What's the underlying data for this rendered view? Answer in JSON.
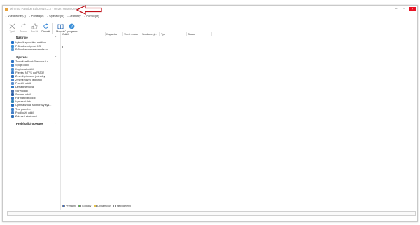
{
  "window": {
    "title": "MiniTool Partition Editor v10.2.3 - Verze: Neomezená"
  },
  "menubar": {
    "items": [
      "Všeobecné(G)",
      "Pohled(V)",
      "Operace(O)",
      "Jednotky",
      "Pomoc(H)"
    ]
  },
  "toolbar": {
    "items": [
      {
        "label": "Zpět",
        "icon": "x-icon"
      },
      {
        "label": "Znovu",
        "icon": "undo-icon"
      },
      {
        "label": "Použít",
        "icon": "thumbs-up-icon"
      },
      {
        "label": "Obnovit",
        "icon": "refresh-icon"
      },
      {
        "label": "Manuál",
        "icon": "book-icon"
      },
      {
        "label": "O programu",
        "icon": "question-icon"
      }
    ]
  },
  "sidebar": {
    "nastroje_title": "Nástroje",
    "nastroje": [
      {
        "label": "Vytvořit spouštěcí médium",
        "color": "#1e6fc9"
      },
      {
        "label": "Průvodce migrací OS",
        "color": "#3a8fd8"
      },
      {
        "label": "Průvodce obnovením disku",
        "color": "#5a9bd5"
      }
    ],
    "operace_title": "Operace",
    "operace": [
      {
        "label": "Změnit velikost/Přesunout o...",
        "color": "#2a72c4"
      },
      {
        "label": "Spojit oddíl",
        "color": "#3f85d1"
      },
      {
        "label": "Kopírovat oddíl",
        "color": "#4a8fd4"
      },
      {
        "label": "Převést NTFS do FAT32",
        "color": "#3a7fcf"
      },
      {
        "label": "Změnit písmeno jednotky",
        "color": "#2c6fbf"
      },
      {
        "label": "Změnit název jednotky",
        "color": "#4b88cf"
      },
      {
        "label": "Prověřit oddíl",
        "color": "#5a8fcf"
      },
      {
        "label": "Defragmentovat",
        "color": "#2f7ac8"
      },
      {
        "label": "Skrýt oddíl",
        "color": "#466fb0"
      },
      {
        "label": "Smazat oddíl",
        "color": "#2b5fa8"
      },
      {
        "label": "Formátovat oddíl",
        "color": "#3678c4"
      },
      {
        "label": "Vymazat data",
        "color": "#2f86b8"
      },
      {
        "label": "Optimalizovat souborový sys...",
        "color": "#1f6cc0"
      },
      {
        "label": "Test povrchu",
        "color": "#3a82ce"
      },
      {
        "label": "Prodloužit oddíl",
        "color": "#4580c8"
      },
      {
        "label": "Zobrazit vlastnosti",
        "color": "#2e6fb8"
      }
    ],
    "pending_title": "Probíhající operace"
  },
  "table": {
    "columns": [
      "Oddíl",
      "Kapacita",
      "Volné místo",
      "Souborový...",
      "Typ",
      "Status"
    ]
  },
  "legend": {
    "items": [
      {
        "label": "Primární",
        "color": "#3b6fcf"
      },
      {
        "label": "Logický",
        "color": "#5cbf4a"
      },
      {
        "label": "Dynamický",
        "color": "#e5c24a"
      },
      {
        "label": "Nepřidělený",
        "color": "#ffffff"
      }
    ]
  },
  "colors": {
    "annotation_arrow": "#c0141c"
  }
}
